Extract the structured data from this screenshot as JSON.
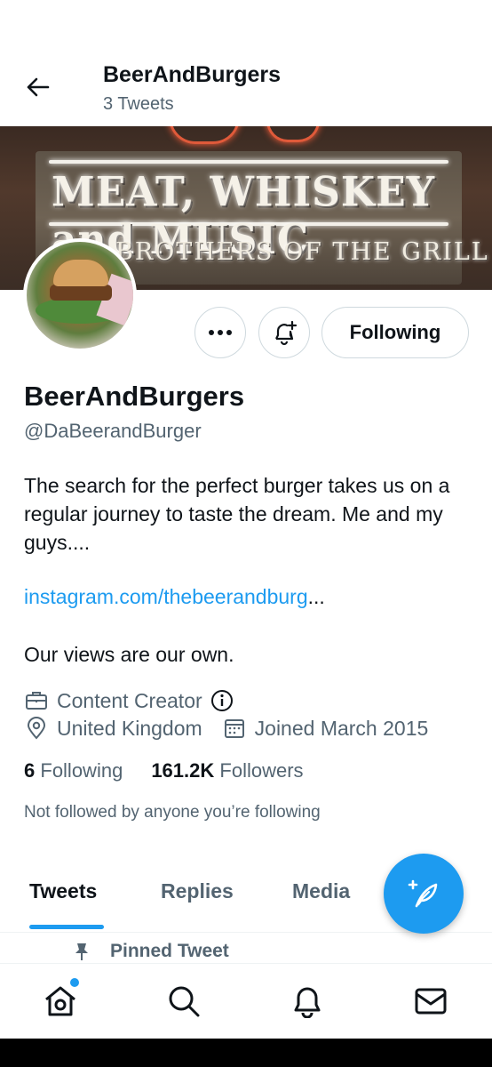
{
  "header": {
    "title": "BeerAndBurgers",
    "subtitle": "3 Tweets",
    "back_icon": "arrow-left-icon"
  },
  "banner": {
    "sign_line1": "MEAT, WHISKEY and MUSIC",
    "sign_line2": "BROTHERS OF THE GRILL"
  },
  "actions": {
    "more_icon": "more-dots-icon",
    "notify_icon": "bell-plus-icon",
    "following_label": "Following"
  },
  "profile": {
    "name": "BeerAndBurgers",
    "handle": "@DaBeerandBurger",
    "bio": "The search for the perfect burger takes us on a regular journey to taste the dream. Me and my guys....",
    "link_text": "instagram.com/thebeerandburg",
    "link_ellipsis": "...",
    "bio_extra": "Our views are our own.",
    "category": "Content Creator",
    "location": "United Kingdom",
    "joined": "Joined March 2015",
    "following_count": "6",
    "following_label": "Following",
    "followers_count": "161.2K",
    "followers_label": "Followers",
    "not_followed": "Not followed by anyone you’re following"
  },
  "tabs": [
    {
      "label": "Tweets",
      "active": true
    },
    {
      "label": "Replies",
      "active": false
    },
    {
      "label": "Media",
      "active": false
    }
  ],
  "pinned_label": "Pinned Tweet",
  "fab_icon": "compose-tweet-icon",
  "bottom_nav": [
    {
      "icon": "home-icon",
      "has_badge": true
    },
    {
      "icon": "search-icon",
      "has_badge": false
    },
    {
      "icon": "bell-icon",
      "has_badge": false
    },
    {
      "icon": "mail-icon",
      "has_badge": false
    }
  ],
  "colors": {
    "accent": "#1d9bf0",
    "text": "#0f1419",
    "secondary": "#536471"
  }
}
